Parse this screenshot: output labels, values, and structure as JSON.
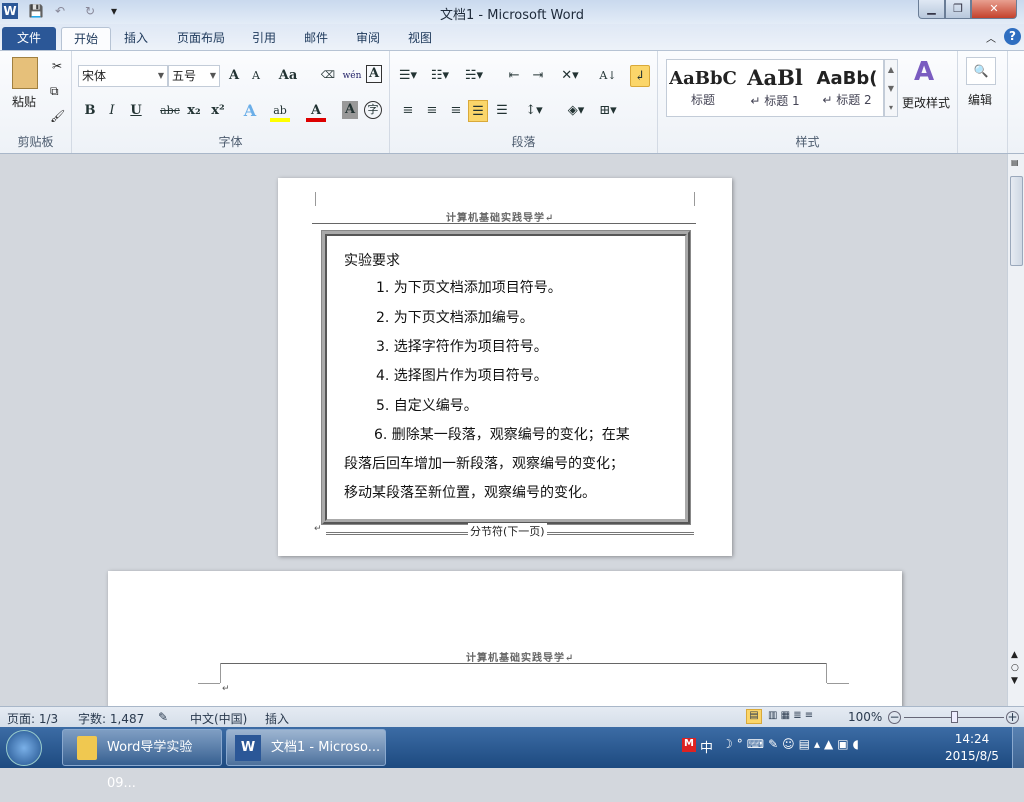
{
  "window": {
    "title": "文档1  -  Microsoft Word",
    "minimize": "▁",
    "restore": "❐",
    "close": "✕"
  },
  "qat": {
    "save": "💾",
    "undo": "↶",
    "redo": "↻",
    "customize": "▾"
  },
  "tabs": [
    {
      "label": "文件"
    },
    {
      "label": "开始"
    },
    {
      "label": "插入"
    },
    {
      "label": "页面布局"
    },
    {
      "label": "引用"
    },
    {
      "label": "邮件"
    },
    {
      "label": "审阅"
    },
    {
      "label": "视图"
    }
  ],
  "ribbon": {
    "clipboard": {
      "paste": "粘贴",
      "label": "剪贴板"
    },
    "font": {
      "name": "宋体",
      "size": "五号",
      "grow": "A",
      "shrink": "A",
      "case": "Aa",
      "bold": "B",
      "italic": "I",
      "underline": "U",
      "strike": "abc",
      "sub": "x₂",
      "sup": "x²",
      "label": "字体",
      "phonetic": "wén",
      "enclose": "字",
      "border": "A",
      "shade": "A",
      "color": "A",
      "highlight": "ab"
    },
    "paragraph": {
      "label": "段落"
    },
    "styles": {
      "items": [
        {
          "sample": "AaBbC",
          "name": "标题"
        },
        {
          "sample": "AaBl",
          "name": "↵ 标题 1"
        },
        {
          "sample": "AaBb(",
          "name": "↵ 标题 2"
        }
      ],
      "label": "样式",
      "change": "更改样式"
    },
    "editing": {
      "label": "编辑"
    }
  },
  "document": {
    "header": "计算机基础实践导学↵",
    "box_title": "实验要求",
    "items": [
      "1.  为下页文档添加项目符号。",
      "2.  为下页文档添加编号。",
      "3.  选择字符作为项目符号。",
      "4.  选择图片作为项目符号。",
      "5.  自定义编号。"
    ],
    "item6": [
      "6. 删除某一段落，观察编号的变化；在某",
      "段落后回车增加一新段落，观察编号的变化；",
      "移动某段落至新位置，观察编号的变化。"
    ],
    "section_break": "分节符(下一页)",
    "page2_header": "计算机基础实践导学↵",
    "para_mark": "↵"
  },
  "status": {
    "page": "页面: 1/3",
    "words": "字数: 1,487",
    "lang": "中文(中国)",
    "mode": "插入",
    "zoom": "100%",
    "zoom_percent": 100
  },
  "taskbar": {
    "items": [
      "Word导学实验09...",
      "文档1 - Microso..."
    ],
    "time": "14:24",
    "date": "2015/8/5",
    "ime": "中"
  }
}
